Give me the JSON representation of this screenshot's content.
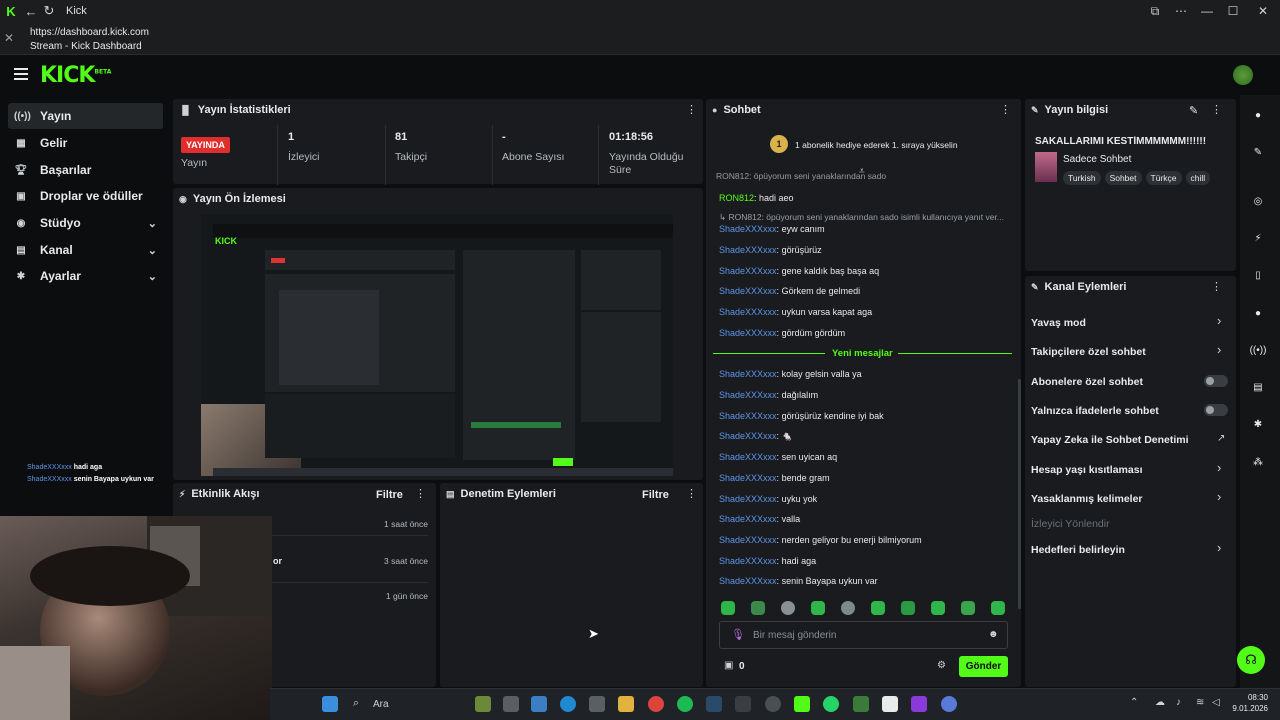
{
  "browser": {
    "tab_title": "Kick",
    "url": "https://dashboard.kick.com",
    "page_title": "Stream - Kick Dashboard"
  },
  "app": {
    "logo": "KICK",
    "logo_tag": "BETA"
  },
  "sidebar": {
    "items": [
      {
        "label": "Yayın",
        "icon": "broadcast-icon",
        "active": true
      },
      {
        "label": "Gelir",
        "icon": "income-icon"
      },
      {
        "label": "Başarılar",
        "icon": "trophy-icon"
      },
      {
        "label": "Droplar ve ödüller",
        "icon": "gift-icon"
      },
      {
        "label": "Stüdyo",
        "icon": "studio-icon",
        "expandable": true
      },
      {
        "label": "Kanal",
        "icon": "channel-icon",
        "expandable": true
      },
      {
        "label": "Ayarlar",
        "icon": "settings-icon",
        "expandable": true
      }
    ]
  },
  "stats": {
    "title": "Yayın İstatistikleri",
    "live_badge": "YAYINDA",
    "live_label": "Yayın",
    "viewers_value": "1",
    "viewers_label": "İzleyici",
    "followers_value": "81",
    "followers_label": "Takipçi",
    "subs_value": "-",
    "subs_label": "Abone Sayısı",
    "duration_value": "01:18:56",
    "duration_label": "Yayında Olduğu Süre"
  },
  "preview": {
    "title": "Yayın Ön İzlemesi"
  },
  "activity": {
    "title": "Etkinlik Akışı",
    "filter": "Filtre",
    "items": [
      {
        "text": "",
        "time": "1 saat önce"
      },
      {
        "text": "or",
        "time": "3 saat önce"
      },
      {
        "text": "",
        "time": "1 gün önce"
      }
    ]
  },
  "moderation": {
    "title": "Denetim Eylemleri",
    "filter": "Filtre"
  },
  "chat": {
    "title": "Sohbet",
    "gift_count": "1",
    "gift_text": "1 abonelik hediye ederek 1. sıraya yükselin",
    "top_partial": "RON812: öpüyorum seni yanaklarından sado",
    "messages_before": [
      {
        "user": "RON812",
        "text": "hadi aeo",
        "green": true
      },
      {
        "reply": "RON812: öpüyorum seni yanaklarından sado isimli kullanıcıya yanıt ver..."
      },
      {
        "user": "ShadeXXXxxx",
        "text": "eyw canım"
      },
      {
        "user": "ShadeXXXxxx",
        "text": "görüşürüz"
      },
      {
        "user": "ShadeXXXxxx",
        "text": "gene kaldık baş başa aq"
      },
      {
        "user": "ShadeXXXxxx",
        "text": "Görkem de gelmedi"
      },
      {
        "user": "ShadeXXXxxx",
        "text": "uykun varsa kapat aga"
      },
      {
        "user": "ShadeXXXxxx",
        "text": "gördüm gördüm"
      }
    ],
    "new_messages": "Yeni mesajlar",
    "messages_after": [
      {
        "user": "ShadeXXXxxx",
        "text": "kolay gelsin valla ya"
      },
      {
        "user": "ShadeXXXxxx",
        "text": "dağılalım"
      },
      {
        "user": "ShadeXXXxxx",
        "text": "görüşürüz kendine iyi bak"
      },
      {
        "user": "ShadeXXXxxx",
        "text": "🐁"
      },
      {
        "user": "ShadeXXXxxx",
        "text": "sen uyican aq"
      },
      {
        "user": "ShadeXXXxxx",
        "text": "bende gram"
      },
      {
        "user": "ShadeXXXxxx",
        "text": "uyku yok"
      },
      {
        "user": "ShadeXXXxxx",
        "text": "valla"
      },
      {
        "user": "ShadeXXXxxx",
        "text": "nerden geliyor bu enerji bilmiyorum"
      },
      {
        "user": "ShadeXXXxxx",
        "text": "hadi aga"
      },
      {
        "user": "ShadeXXXxxx",
        "text": "senin Bayapa uykun var"
      }
    ],
    "input_placeholder": "Bir mesaj gönderin",
    "points": "0",
    "send": "Gönder"
  },
  "stream_info": {
    "title_label": "Yayın bilgisi",
    "stream_title": "SAKALLARIMI KESTİMMMMMM!!!!!!",
    "category": "Sadece Sohbet",
    "tags": [
      "Turkish",
      "Sohbet",
      "Türkçe",
      "chill"
    ]
  },
  "channel_actions": {
    "title": "Kanal Eylemleri",
    "items": [
      {
        "label": "Yavaş mod",
        "kind": "chevron"
      },
      {
        "label": "Takipçilere özel sohbet",
        "kind": "chevron"
      },
      {
        "label": "Abonelere özel sohbet",
        "kind": "toggle"
      },
      {
        "label": "Yalnızca ifadelerle sohbet",
        "kind": "toggle"
      },
      {
        "label": "Yapay Zeka ile Sohbet Denetimi",
        "kind": "external"
      },
      {
        "label": "Hesap yaşı kısıtlaması",
        "kind": "chevron"
      },
      {
        "label": "Yasaklanmış kelimeler",
        "kind": "chevron"
      },
      {
        "label": "İzleyici Yönlendir",
        "kind": "disabled"
      },
      {
        "label": "Hedefleri belirleyin",
        "kind": "chevron"
      }
    ]
  },
  "overlay_chat": [
    {
      "user": "ShadeXXXxxx",
      "text": "hadi aga"
    },
    {
      "user": "ShadeXXXxxx",
      "text": "senin Bayapa uykun var"
    }
  ],
  "taskbar": {
    "search": "Ara",
    "time": "08:30",
    "date": "9.01.2026"
  }
}
